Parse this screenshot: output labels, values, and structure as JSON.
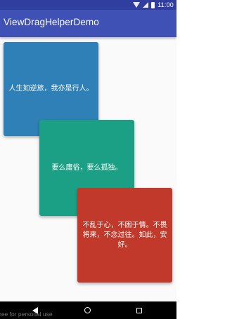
{
  "status_bar": {
    "time": "11:00",
    "icons": [
      "wifi-icon",
      "cell-signal-icon",
      "battery-icon"
    ]
  },
  "app_bar": {
    "title": "ViewDragHelperDemo"
  },
  "cards": [
    {
      "text": "人生如逆旅，我亦是行人。",
      "color": "#2e80b7"
    },
    {
      "text": "要么庸俗，要么孤独。",
      "color": "#1ca085"
    },
    {
      "text": "不乱于心，不困于情。不畏将来，不念过往。如此，安好。",
      "color": "#c0392b"
    }
  ],
  "watermark": "ree for personal use",
  "nav_bar": {
    "icons": [
      "back-icon",
      "home-icon",
      "recents-icon"
    ]
  },
  "colors": {
    "status_bar": "#303f9f",
    "app_bar": "#3f51b5",
    "background": "#fafafa",
    "nav_bar": "#000000"
  }
}
